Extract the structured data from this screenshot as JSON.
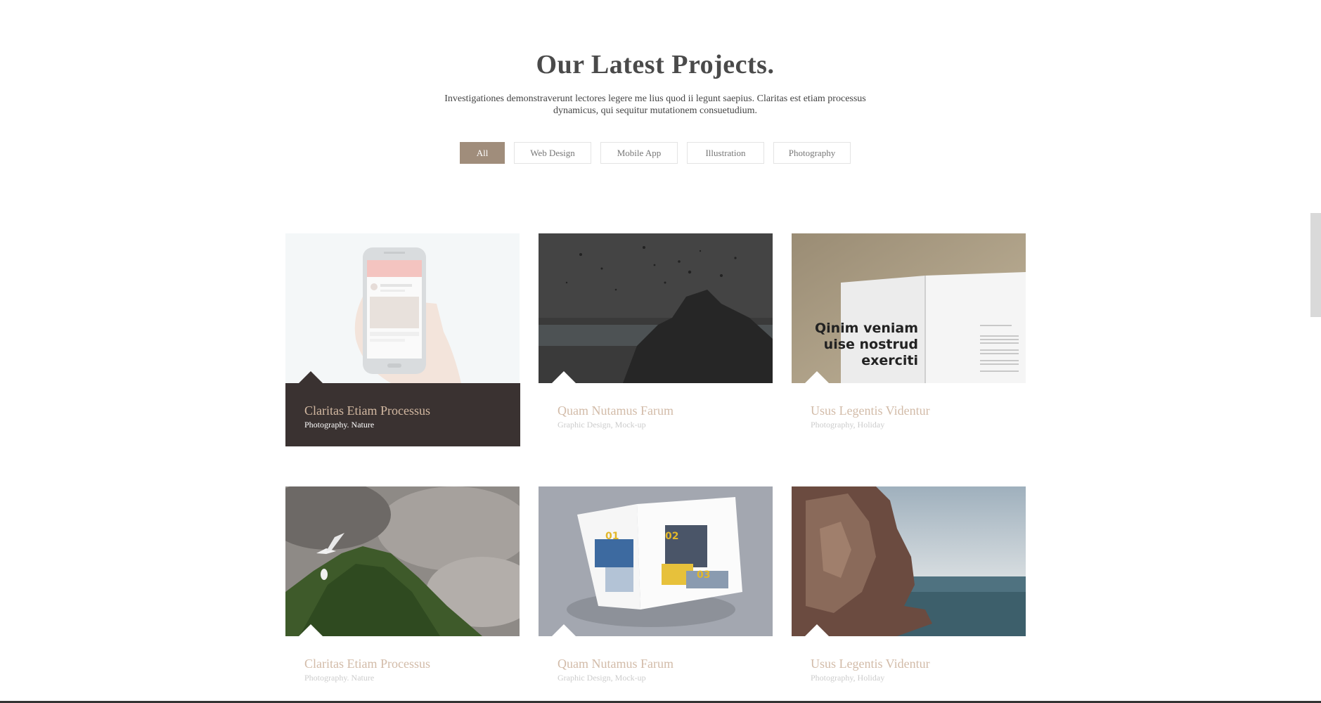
{
  "section": {
    "title": "Our Latest Projects.",
    "description": "Investigationes demonstraverunt lectores legere me lius quod ii legunt saepius. Claritas est etiam processus dynamicus, qui sequitur mutationem consuetudium."
  },
  "filters": {
    "items": [
      "All",
      "Web Design",
      "Mobile App",
      "Illustration",
      "Photography"
    ],
    "active": "All"
  },
  "projects": [
    {
      "title": "Claritas Etiam Processus",
      "meta": "Photography. Nature",
      "image": "phone-app-mockup",
      "active": true
    },
    {
      "title": "Quam Nutamus Farum",
      "meta": "Graphic Design, Mock-up",
      "image": "dark-rock-splash"
    },
    {
      "title": "Usus Legentis Videntur",
      "meta": "Photography, Holiday",
      "image": "book-mockup",
      "book_text": [
        "Qinim veniam",
        "uise nostrud",
        "exerciti"
      ]
    },
    {
      "title": "Claritas Etiam Processus",
      "meta": "Photography. Nature",
      "image": "mossy-cliff-birds"
    },
    {
      "title": "Quam Nutamus Farum",
      "meta": "Graphic Design, Mock-up",
      "image": "magazine-mockup",
      "magazine_numbers": [
        "01",
        "02",
        "03"
      ]
    },
    {
      "title": "Usus Legentis Videntur",
      "meta": "Photography, Holiday",
      "image": "sea-rock"
    }
  ],
  "colors": {
    "accent": "#a08d7b",
    "active_card_bg": "#3a3231",
    "project_title": "#d2bba8"
  }
}
